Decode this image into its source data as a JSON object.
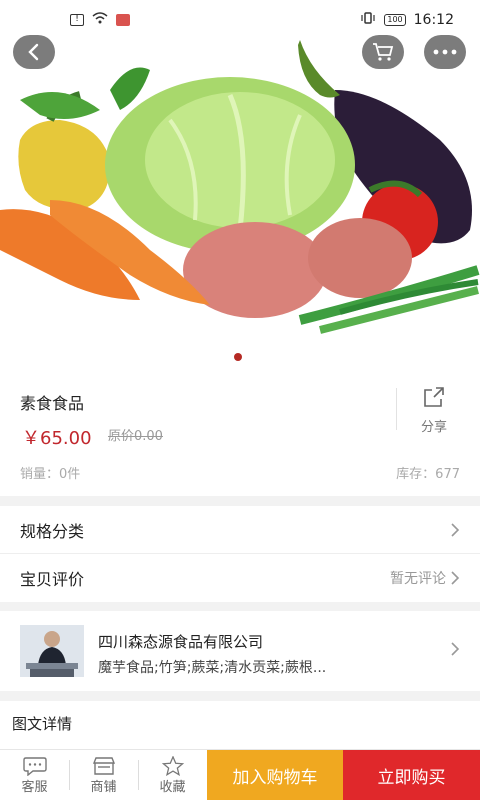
{
  "status": {
    "time": "16:12",
    "battery": "100"
  },
  "product": {
    "title": "素食食品",
    "price": "￥65.00",
    "old_price": "原价0.00",
    "share_label": "分享",
    "sales": "销量：0件",
    "stock": "库存：677"
  },
  "rows": {
    "spec_label": "规格分类",
    "review_label": "宝贝评价",
    "review_value": "暂无评论"
  },
  "shop": {
    "name": "四川森态源食品有限公司",
    "categories": "魔芋食品;竹笋;蕨菜;清水贡菜;蕨根..."
  },
  "details": {
    "title": "图文详情"
  },
  "bottom": {
    "service": "客服",
    "shop": "商铺",
    "favorite": "收藏",
    "add_cart": "加入购物车",
    "buy_now": "立即购买"
  },
  "colors": {
    "price": "#c1272d",
    "cart_button": "#f0a820",
    "buy_button": "#e0282b",
    "dot_active": "#b52a24"
  },
  "icons": [
    "back-icon",
    "cart-icon",
    "more-icon",
    "share-icon",
    "chevron-right-icon",
    "chat-icon",
    "store-icon",
    "star-icon"
  ]
}
